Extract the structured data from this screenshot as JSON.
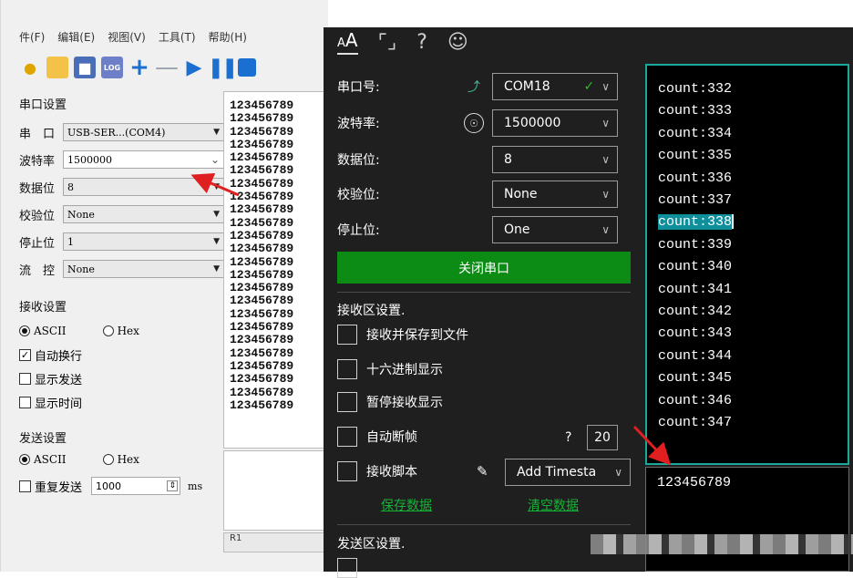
{
  "left": {
    "menu": [
      "件(F)",
      "编辑(E)",
      "视图(V)",
      "工具(T)",
      "帮助(H)"
    ],
    "toolbar": {
      "log_label": "LOG"
    },
    "serial_section": "串口设置",
    "serial_port": {
      "label": "串　口",
      "value": "USB-SER...(COM4)"
    },
    "baud": {
      "label": "波特率",
      "value": "1500000"
    },
    "data_bits": {
      "label": "数据位",
      "value": "8"
    },
    "parity": {
      "label": "校验位",
      "value": "None"
    },
    "stop_bits": {
      "label": "停止位",
      "value": "1"
    },
    "flow": {
      "label": "流　控",
      "value": "None"
    },
    "receive_section": "接收设置",
    "rx_ascii": "ASCII",
    "rx_hex": "Hex",
    "auto_newline": "自动换行",
    "show_send": "显示发送",
    "show_time": "显示时间",
    "send_section": "发送设置",
    "tx_ascii": "ASCII",
    "tx_hex": "Hex",
    "repeat_send": "重复发送",
    "repeat_interval": "1000",
    "repeat_unit": "ms",
    "rx_lines": [
      "123456789",
      "123456789",
      "123456789",
      "123456789",
      "123456789",
      "123456789",
      "123456789",
      "123456789",
      "123456789",
      "123456789",
      "123456789",
      "123456789",
      "123456789",
      "123456789",
      "123456789",
      "123456789",
      "123456789",
      "123456789",
      "123456789",
      "123456789",
      "123456789",
      "123456789",
      "123456789",
      "123456789"
    ],
    "status_text": "R1"
  },
  "right": {
    "serial_port": {
      "label": "串口号:",
      "value": "COM18"
    },
    "baud": {
      "label": "波特率:",
      "value": "1500000"
    },
    "data_bits": {
      "label": "数据位:",
      "value": "8"
    },
    "parity": {
      "label": "校验位:",
      "value": "None"
    },
    "stop_bits": {
      "label": "停止位:",
      "value": "One"
    },
    "close_button": "关闭串口",
    "receive_section": "接收区设置.",
    "recv_save_file": "接收并保存到文件",
    "hex_display": "十六进制显示",
    "pause_display": "暂停接收显示",
    "auto_frame": "自动断帧",
    "auto_frame_help": "?",
    "auto_frame_value": "20",
    "recv_script": "接收脚本",
    "script_option": "Add Timesta",
    "save_data": "保存数据",
    "clear_data": "清空数据",
    "send_section": "发送区设置.",
    "rx_lines": [
      "count:332",
      "count:333",
      "count:334",
      "count:335",
      "count:336",
      "count:337",
      "count:338",
      "count:339",
      "count:340",
      "count:341",
      "count:342",
      "count:343",
      "count:344",
      "count:345",
      "count:346",
      "count:347"
    ],
    "tx_text": "123456789"
  },
  "colors": {
    "accent_green": "#0d8c15",
    "accent_teal": "#1aa89a",
    "arrow_red": "#e02020"
  }
}
